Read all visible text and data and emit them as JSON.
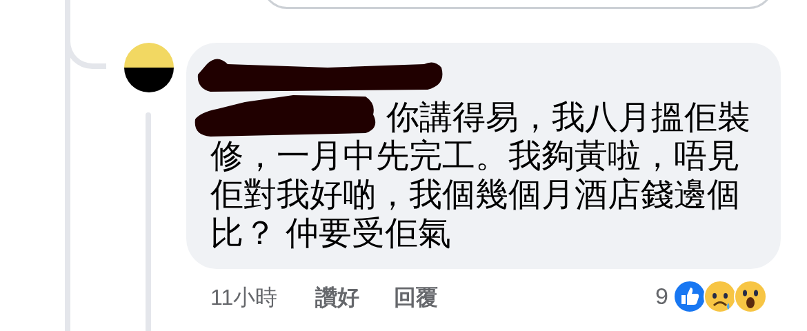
{
  "comment": {
    "text": "你講得易，我八月搵佢裝修，一月中先完工。我夠黃啦，唔見佢對我好啲，我個幾個月酒店錢邊個比？ 仲要受佢氣",
    "time": "11小時",
    "actions": [
      "讚好",
      "回覆"
    ],
    "reaction_count": "9"
  }
}
